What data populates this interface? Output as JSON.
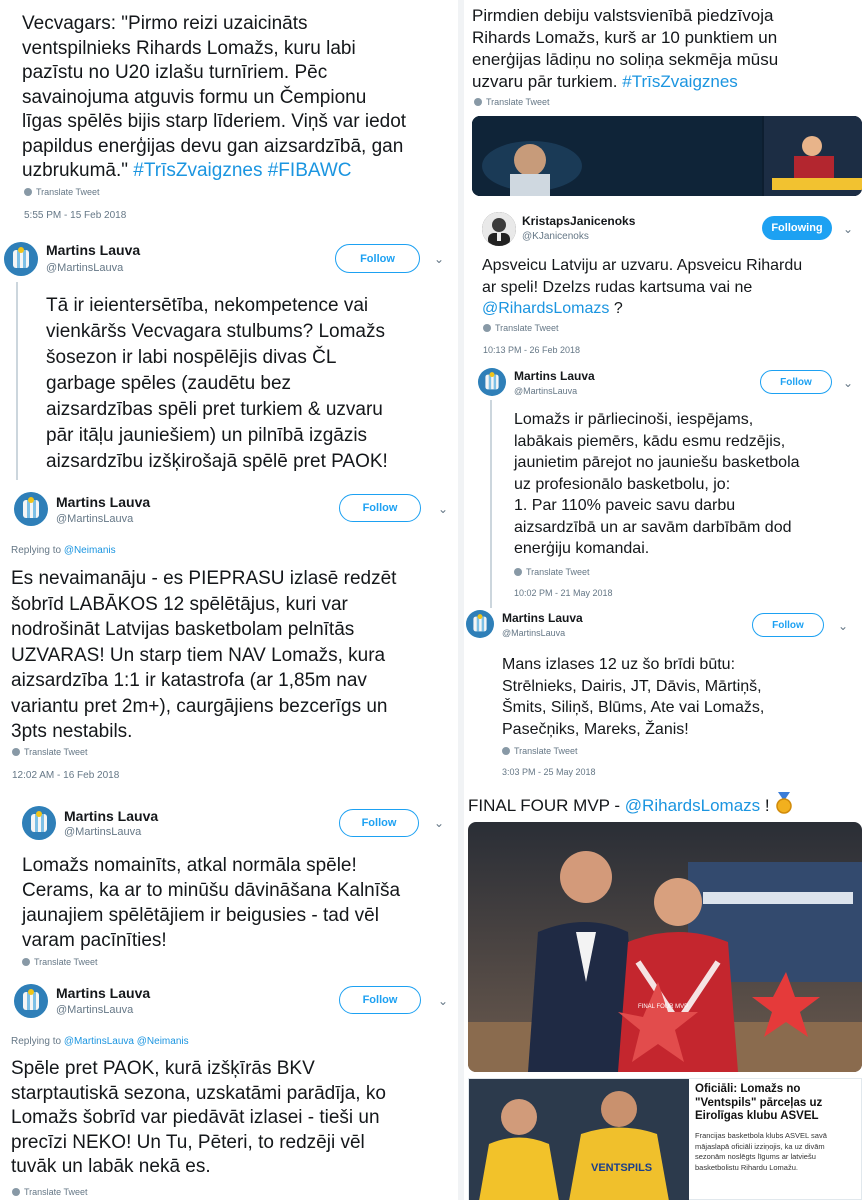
{
  "left": {
    "t1": {
      "lines": [
        "Vecvagars: \"Pirmo reizi uzaicināts",
        "ventspilnieks Rihards Lomažs, kuru labi",
        "pazīstu no U20 izlašu turnīriem. Pēc",
        "savainojuma atguvis formu un Čempionu",
        "līgas spēlēs bijis starp līderiem. Viņš var iedot",
        "papildus enerģijas devu gan aizsardzībā, gan",
        "uzbrukumā.\""
      ],
      "hashtags": "#TrīsZvaigznes #FIBAWC",
      "translate": "Translate Tweet",
      "time": "5:55 PM - 15 Feb 2018"
    },
    "t2": {
      "name": "Martins Lauva",
      "handle": "@MartinsLauva",
      "follow": "Follow",
      "lines": [
        "Tā ir ieientersētība, nekompetence vai",
        "vienkāršs Vecvagara stulbums?  Lomažs",
        "šosezon ir labi nospēlējis divas ČL",
        "garbage spēles (zaudētu  bez",
        "aizsardzības spēli pret turkiem & uzvaru",
        "pār itāļu jauniešiem)  un pilnībā izgāzis",
        "aizsardzību izšķirošajā spēlē pret PAOK!"
      ]
    },
    "t3": {
      "name": "Martins Lauva",
      "handle": "@MartinsLauva",
      "follow": "Follow",
      "replying_prefix": "Replying to",
      "replying_to": "@Neimanis",
      "lines": [
        "Es nevaimanāju - es PIEPRASU izlasē redzēt",
        "šobrīd LABĀKOS 12 spēlētājus, kuri var",
        "nodrošināt Latvijas basketbolam pelnītās",
        "UZVARAS! Un starp tiem NAV Lomažs, kura",
        "aizsardzība 1:1 ir katastrofa (ar 1,85m nav",
        "variantu pret 2m+), caurgājiens bezcerīgs un",
        "3pts nestabils."
      ],
      "translate": "Translate Tweet",
      "time": "12:02 AM - 16 Feb 2018"
    },
    "t4": {
      "name": "Martins Lauva",
      "handle": "@MartinsLauva",
      "follow": "Follow",
      "lines": [
        "Lomažs nomainīts, atkal normāla spēle!",
        "Cerams, ka ar to minūšu dāvināšana Kalnīša",
        "jaunajiem spēlētājiem ir beigusies - tad vēl",
        "varam pacīnīties!"
      ],
      "translate": "Translate Tweet"
    },
    "t5": {
      "name": "Martins Lauva",
      "handle": "@MartinsLauva",
      "follow": "Follow",
      "replying_prefix": "Replying to",
      "replying_to": "@MartinsLauva @Neimanis",
      "lines": [
        "Spēle pret PAOK, kurā izšķīrās BKV",
        "starptautiskā sezona, uzskatāmi parādīja, ko",
        "Lomažs šobrīd var piedāvāt izlasei - tieši un",
        "precīzi NEKO! Un Tu, Pēteri, to redzēji vēl",
        "tuvāk un labāk nekā es."
      ],
      "translate": "Translate Tweet"
    }
  },
  "right": {
    "r1": {
      "lines": [
        "Pirmdien debiju valstsvienībā piedzīvoja",
        "Rihards Lomažs, kurš ar 10 punktiem un",
        "enerģijas lādiņu no soliņa sekmēja mūsu",
        "uzvaru pār turkiem."
      ],
      "hashtag": "#TrīsZvaigznes",
      "translate": "Translate Tweet"
    },
    "r2": {
      "name": "KristapsJanicenoks",
      "handle": "@KJanicenoks",
      "follow": "Following",
      "lines": [
        "Apsveicu Latviju ar uzvaru. Apsveicu Rihardu",
        "ar speli! Dzelzs rudas kartsuma vai ne"
      ],
      "mention": "@RihardsLomazs",
      "mention_suffix": " ?",
      "translate": "Translate Tweet",
      "time": "10:13 PM - 26 Feb 2018"
    },
    "r3": {
      "name": "Martins Lauva",
      "handle": "@MartinsLauva",
      "follow": "Follow",
      "lines": [
        "Lomažs ir pārliecinoši, iespējams,",
        "labākais piemērs, kādu esmu redzējis,",
        "jaunietim pārejot no jauniešu basketbola",
        "uz profesionālo basketbolu, jo:",
        "1. Par 110% paveic savu darbu",
        "aizsardzībā un ar savām darbībām dod",
        "enerģiju komandai."
      ],
      "translate": "Translate Tweet",
      "time": "10:02 PM - 21 May 2018"
    },
    "r4": {
      "name": "Martins Lauva",
      "handle": "@MartinsLauva",
      "follow": "Follow",
      "lines": [
        "Mans izlases 12 uz šo brīdi būtu:",
        "Strēlnieks, Dairis, JT, Dāvis, Mārtiņš,",
        "Šmits, Siliņš, Blūms, Ate vai Lomažs,",
        "Pasečņiks, Mareks, Žanis!"
      ],
      "translate": "Translate Tweet",
      "time": "3:03 PM - 25 May 2018"
    },
    "r5": {
      "prefix": "FINAL FOUR MVP - ",
      "mention": "@RihardsLomazs",
      "suffix": " !",
      "photo_banner": "FINAL FOUR MVP"
    },
    "news": {
      "title_lines": [
        "Oficiāli: Lomažs no",
        "\"Ventspils\" pārceļas uz",
        "Eirolīgas klubu ASVEL"
      ],
      "body_lines": [
        "Francijas basketbola klubs ASVEL savā",
        "mājaslapā oficiāli izziņojis, ka uz divām",
        "sezonām noslēgts līgums ar latviešu",
        "basketbolistu Rihardu Lomažu."
      ],
      "jersey": "VENTSPILS"
    }
  },
  "colors": {
    "link": "#1b95e0",
    "follow": "#1da1f2",
    "text": "#14171a",
    "muted": "#657786"
  }
}
